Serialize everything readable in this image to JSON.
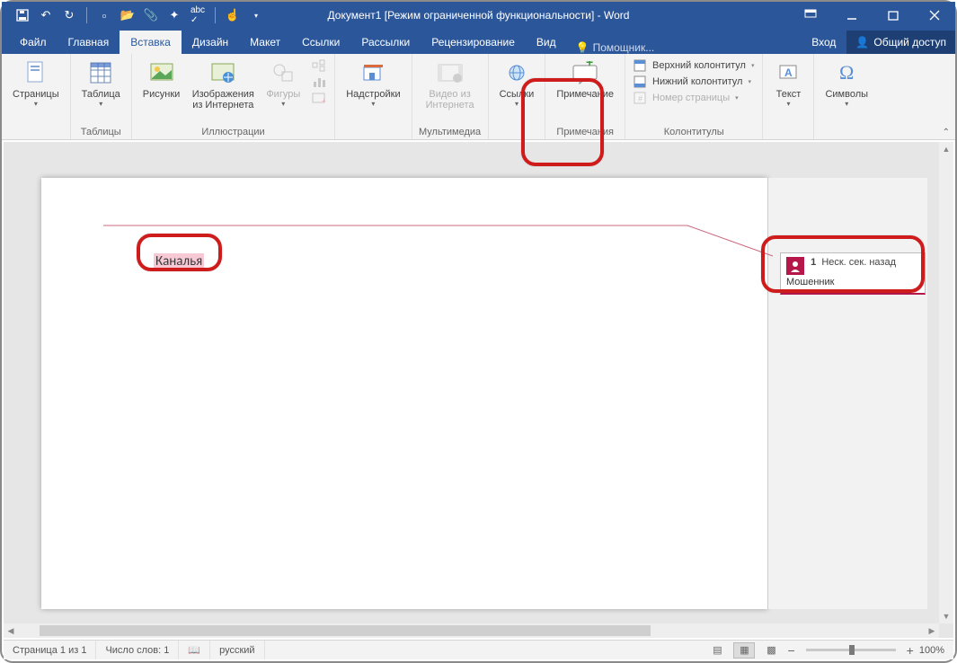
{
  "title": "Документ1 [Режим ограниченной функциональности] - Word",
  "qat": {
    "save": "save",
    "undo": "undo",
    "redo": "redo"
  },
  "tabs": {
    "file": "Файл",
    "home": "Главная",
    "insert": "Вставка",
    "design": "Дизайн",
    "layout": "Макет",
    "references": "Ссылки",
    "mailings": "Рассылки",
    "review": "Рецензирование",
    "view": "Вид",
    "tellme": "Помощник...",
    "signin": "Вход",
    "share": "Общий доступ"
  },
  "ribbon": {
    "pages": {
      "label": "Страницы",
      "btn": "Страницы"
    },
    "tables": {
      "label": "Таблицы",
      "btn": "Таблица"
    },
    "illustrations": {
      "label": "Иллюстрации",
      "pics": "Рисунки",
      "online": "Изображения из Интернета",
      "shapes": "Фигуры"
    },
    "addins": {
      "label": "Надстройки",
      "btn": "Надстройки"
    },
    "media": {
      "label": "Мультимедиа",
      "btn": "Видео из Интернета"
    },
    "links": {
      "label": "",
      "btn": "Ссылки"
    },
    "comments": {
      "label": "Примечания",
      "btn": "Примечание"
    },
    "headerfooter": {
      "label": "Колонтитулы",
      "header": "Верхний колонтитул",
      "footer": "Нижний колонтитул",
      "pagenum": "Номер страницы"
    },
    "text": {
      "label": "",
      "btn": "Текст"
    },
    "symbols": {
      "label": "",
      "btn": "Символы"
    }
  },
  "document": {
    "selected_text": "Каналья"
  },
  "comment": {
    "author_num": "1",
    "timestamp": "Неск. сек. назад",
    "body": "Мошенник"
  },
  "statusbar": {
    "page": "Страница 1 из 1",
    "words": "Число слов: 1",
    "lang": "русский",
    "zoom": "100%"
  }
}
